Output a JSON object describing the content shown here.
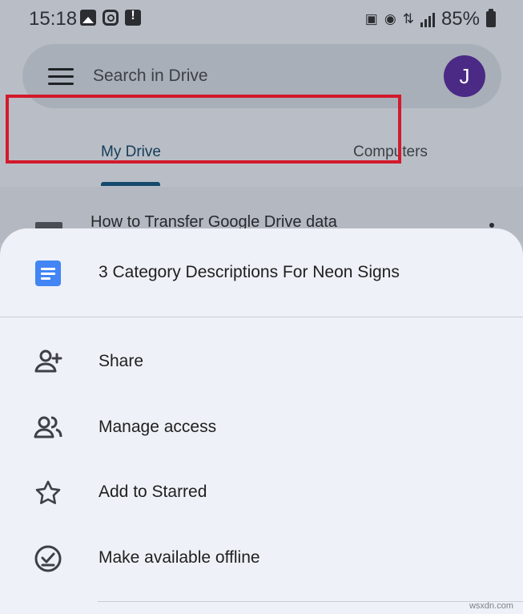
{
  "status_bar": {
    "time": "15:18",
    "battery": "85%"
  },
  "search": {
    "placeholder": "Search in Drive",
    "avatar_initial": "J"
  },
  "tabs": {
    "items": [
      {
        "label": "My Drive",
        "active": true
      },
      {
        "label": "Computers",
        "active": false
      }
    ]
  },
  "background_row": {
    "text": "How to Transfer Google Drive data",
    "icon": "folder-icon"
  },
  "sheet": {
    "file_title": "3 Category Descriptions For Neon Signs",
    "file_icon": "docs-icon",
    "items": [
      {
        "label": "Share",
        "icon": "person-add-icon"
      },
      {
        "label": "Manage access",
        "icon": "people-icon"
      },
      {
        "label": "Add to Starred",
        "icon": "star-icon"
      },
      {
        "label": "Make available offline",
        "icon": "offline-check-icon"
      }
    ]
  },
  "watermark": "wsxdn.com"
}
